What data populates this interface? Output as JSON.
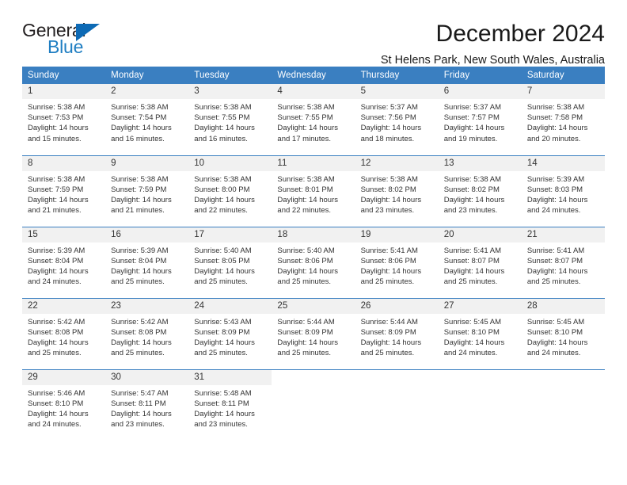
{
  "logo": {
    "word1": "General",
    "word2": "Blue",
    "triangle_color": "#0d6ab5",
    "icon": "triangle-icon"
  },
  "header": {
    "month_title": "December 2024",
    "location": "St Helens Park, New South Wales, Australia"
  },
  "theme": {
    "header_blue": "#3a7fc1",
    "daynum_gray": "#f1f1f1",
    "text": "#333333",
    "logo_blue": "#1f7ec2"
  },
  "weekdays": [
    "Sunday",
    "Monday",
    "Tuesday",
    "Wednesday",
    "Thursday",
    "Friday",
    "Saturday"
  ],
  "weeks": [
    [
      {
        "day": "1",
        "sunrise": "Sunrise: 5:38 AM",
        "sunset": "Sunset: 7:53 PM",
        "daylight1": "Daylight: 14 hours",
        "daylight2": "and 15 minutes."
      },
      {
        "day": "2",
        "sunrise": "Sunrise: 5:38 AM",
        "sunset": "Sunset: 7:54 PM",
        "daylight1": "Daylight: 14 hours",
        "daylight2": "and 16 minutes."
      },
      {
        "day": "3",
        "sunrise": "Sunrise: 5:38 AM",
        "sunset": "Sunset: 7:55 PM",
        "daylight1": "Daylight: 14 hours",
        "daylight2": "and 16 minutes."
      },
      {
        "day": "4",
        "sunrise": "Sunrise: 5:38 AM",
        "sunset": "Sunset: 7:55 PM",
        "daylight1": "Daylight: 14 hours",
        "daylight2": "and 17 minutes."
      },
      {
        "day": "5",
        "sunrise": "Sunrise: 5:37 AM",
        "sunset": "Sunset: 7:56 PM",
        "daylight1": "Daylight: 14 hours",
        "daylight2": "and 18 minutes."
      },
      {
        "day": "6",
        "sunrise": "Sunrise: 5:37 AM",
        "sunset": "Sunset: 7:57 PM",
        "daylight1": "Daylight: 14 hours",
        "daylight2": "and 19 minutes."
      },
      {
        "day": "7",
        "sunrise": "Sunrise: 5:38 AM",
        "sunset": "Sunset: 7:58 PM",
        "daylight1": "Daylight: 14 hours",
        "daylight2": "and 20 minutes."
      }
    ],
    [
      {
        "day": "8",
        "sunrise": "Sunrise: 5:38 AM",
        "sunset": "Sunset: 7:59 PM",
        "daylight1": "Daylight: 14 hours",
        "daylight2": "and 21 minutes."
      },
      {
        "day": "9",
        "sunrise": "Sunrise: 5:38 AM",
        "sunset": "Sunset: 7:59 PM",
        "daylight1": "Daylight: 14 hours",
        "daylight2": "and 21 minutes."
      },
      {
        "day": "10",
        "sunrise": "Sunrise: 5:38 AM",
        "sunset": "Sunset: 8:00 PM",
        "daylight1": "Daylight: 14 hours",
        "daylight2": "and 22 minutes."
      },
      {
        "day": "11",
        "sunrise": "Sunrise: 5:38 AM",
        "sunset": "Sunset: 8:01 PM",
        "daylight1": "Daylight: 14 hours",
        "daylight2": "and 22 minutes."
      },
      {
        "day": "12",
        "sunrise": "Sunrise: 5:38 AM",
        "sunset": "Sunset: 8:02 PM",
        "daylight1": "Daylight: 14 hours",
        "daylight2": "and 23 minutes."
      },
      {
        "day": "13",
        "sunrise": "Sunrise: 5:38 AM",
        "sunset": "Sunset: 8:02 PM",
        "daylight1": "Daylight: 14 hours",
        "daylight2": "and 23 minutes."
      },
      {
        "day": "14",
        "sunrise": "Sunrise: 5:39 AM",
        "sunset": "Sunset: 8:03 PM",
        "daylight1": "Daylight: 14 hours",
        "daylight2": "and 24 minutes."
      }
    ],
    [
      {
        "day": "15",
        "sunrise": "Sunrise: 5:39 AM",
        "sunset": "Sunset: 8:04 PM",
        "daylight1": "Daylight: 14 hours",
        "daylight2": "and 24 minutes."
      },
      {
        "day": "16",
        "sunrise": "Sunrise: 5:39 AM",
        "sunset": "Sunset: 8:04 PM",
        "daylight1": "Daylight: 14 hours",
        "daylight2": "and 25 minutes."
      },
      {
        "day": "17",
        "sunrise": "Sunrise: 5:40 AM",
        "sunset": "Sunset: 8:05 PM",
        "daylight1": "Daylight: 14 hours",
        "daylight2": "and 25 minutes."
      },
      {
        "day": "18",
        "sunrise": "Sunrise: 5:40 AM",
        "sunset": "Sunset: 8:06 PM",
        "daylight1": "Daylight: 14 hours",
        "daylight2": "and 25 minutes."
      },
      {
        "day": "19",
        "sunrise": "Sunrise: 5:41 AM",
        "sunset": "Sunset: 8:06 PM",
        "daylight1": "Daylight: 14 hours",
        "daylight2": "and 25 minutes."
      },
      {
        "day": "20",
        "sunrise": "Sunrise: 5:41 AM",
        "sunset": "Sunset: 8:07 PM",
        "daylight1": "Daylight: 14 hours",
        "daylight2": "and 25 minutes."
      },
      {
        "day": "21",
        "sunrise": "Sunrise: 5:41 AM",
        "sunset": "Sunset: 8:07 PM",
        "daylight1": "Daylight: 14 hours",
        "daylight2": "and 25 minutes."
      }
    ],
    [
      {
        "day": "22",
        "sunrise": "Sunrise: 5:42 AM",
        "sunset": "Sunset: 8:08 PM",
        "daylight1": "Daylight: 14 hours",
        "daylight2": "and 25 minutes."
      },
      {
        "day": "23",
        "sunrise": "Sunrise: 5:42 AM",
        "sunset": "Sunset: 8:08 PM",
        "daylight1": "Daylight: 14 hours",
        "daylight2": "and 25 minutes."
      },
      {
        "day": "24",
        "sunrise": "Sunrise: 5:43 AM",
        "sunset": "Sunset: 8:09 PM",
        "daylight1": "Daylight: 14 hours",
        "daylight2": "and 25 minutes."
      },
      {
        "day": "25",
        "sunrise": "Sunrise: 5:44 AM",
        "sunset": "Sunset: 8:09 PM",
        "daylight1": "Daylight: 14 hours",
        "daylight2": "and 25 minutes."
      },
      {
        "day": "26",
        "sunrise": "Sunrise: 5:44 AM",
        "sunset": "Sunset: 8:09 PM",
        "daylight1": "Daylight: 14 hours",
        "daylight2": "and 25 minutes."
      },
      {
        "day": "27",
        "sunrise": "Sunrise: 5:45 AM",
        "sunset": "Sunset: 8:10 PM",
        "daylight1": "Daylight: 14 hours",
        "daylight2": "and 24 minutes."
      },
      {
        "day": "28",
        "sunrise": "Sunrise: 5:45 AM",
        "sunset": "Sunset: 8:10 PM",
        "daylight1": "Daylight: 14 hours",
        "daylight2": "and 24 minutes."
      }
    ],
    [
      {
        "day": "29",
        "sunrise": "Sunrise: 5:46 AM",
        "sunset": "Sunset: 8:10 PM",
        "daylight1": "Daylight: 14 hours",
        "daylight2": "and 24 minutes."
      },
      {
        "day": "30",
        "sunrise": "Sunrise: 5:47 AM",
        "sunset": "Sunset: 8:11 PM",
        "daylight1": "Daylight: 14 hours",
        "daylight2": "and 23 minutes."
      },
      {
        "day": "31",
        "sunrise": "Sunrise: 5:48 AM",
        "sunset": "Sunset: 8:11 PM",
        "daylight1": "Daylight: 14 hours",
        "daylight2": "and 23 minutes."
      },
      {
        "day": "",
        "sunrise": "",
        "sunset": "",
        "daylight1": "",
        "daylight2": ""
      },
      {
        "day": "",
        "sunrise": "",
        "sunset": "",
        "daylight1": "",
        "daylight2": ""
      },
      {
        "day": "",
        "sunrise": "",
        "sunset": "",
        "daylight1": "",
        "daylight2": ""
      },
      {
        "day": "",
        "sunrise": "",
        "sunset": "",
        "daylight1": "",
        "daylight2": ""
      }
    ]
  ]
}
